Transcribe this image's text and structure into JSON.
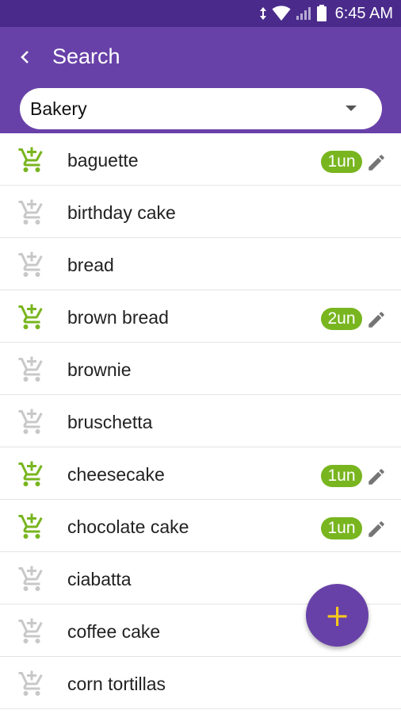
{
  "status_bar": {
    "time": "6:45 AM",
    "icons": [
      "data-arrows-icon",
      "wifi-icon",
      "signal-icon",
      "battery-icon"
    ]
  },
  "app_bar": {
    "title": "Search",
    "back_icon": "chevron-left-icon"
  },
  "category_dropdown": {
    "selected": "Bakery"
  },
  "colors": {
    "status_bar": "#4a2b8c",
    "app_bar": "#6841a8",
    "accent_green": "#78b51f",
    "inactive_gray": "#c8c8c8",
    "fab_plus": "#f6c81e"
  },
  "items": [
    {
      "name": "baguette",
      "in_cart": true,
      "quantity": "1un"
    },
    {
      "name": "birthday cake",
      "in_cart": false,
      "quantity": null
    },
    {
      "name": "bread",
      "in_cart": false,
      "quantity": null
    },
    {
      "name": "brown bread",
      "in_cart": true,
      "quantity": "2un"
    },
    {
      "name": "brownie",
      "in_cart": false,
      "quantity": null
    },
    {
      "name": "bruschetta",
      "in_cart": false,
      "quantity": null
    },
    {
      "name": "cheesecake",
      "in_cart": true,
      "quantity": "1un"
    },
    {
      "name": "chocolate cake",
      "in_cart": true,
      "quantity": "1un"
    },
    {
      "name": "ciabatta",
      "in_cart": false,
      "quantity": null
    },
    {
      "name": "coffee cake",
      "in_cart": false,
      "quantity": null
    },
    {
      "name": "corn tortillas",
      "in_cart": false,
      "quantity": null
    }
  ],
  "fab": {
    "label": "+"
  }
}
